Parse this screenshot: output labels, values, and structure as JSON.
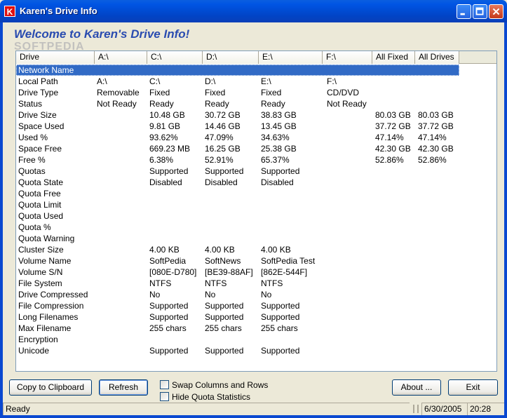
{
  "window": {
    "title": "Karen's Drive Info",
    "icon_letter": "K",
    "welcome": "Welcome to Karen's Drive Info!",
    "watermark": "SOFTPEDIA"
  },
  "table": {
    "headers": [
      "Drive",
      "A:\\",
      "C:\\",
      "D:\\",
      "E:\\",
      "F:\\",
      "All Fixed",
      "All Drives"
    ],
    "rows": [
      [
        "Network Name",
        "",
        "",
        "",
        "",
        "",
        "",
        ""
      ],
      [
        "Local Path",
        "A:\\",
        "C:\\",
        "D:\\",
        "E:\\",
        "F:\\",
        "",
        ""
      ],
      [
        "Drive Type",
        "Removable",
        "Fixed",
        "Fixed",
        "Fixed",
        "CD/DVD",
        "",
        ""
      ],
      [
        "Status",
        "Not Ready",
        "Ready",
        "Ready",
        "Ready",
        "Not Ready",
        "",
        ""
      ],
      [
        "Drive Size",
        "",
        "10.48 GB",
        "30.72 GB",
        "38.83 GB",
        "",
        "80.03 GB",
        "80.03 GB"
      ],
      [
        "Space Used",
        "",
        "9.81 GB",
        "14.46 GB",
        "13.45 GB",
        "",
        "37.72 GB",
        "37.72 GB"
      ],
      [
        "Used %",
        "",
        "93.62%",
        "47.09%",
        "34.63%",
        "",
        "47.14%",
        "47.14%"
      ],
      [
        "Space Free",
        "",
        "669.23 MB",
        "16.25 GB",
        "25.38 GB",
        "",
        "42.30 GB",
        "42.30 GB"
      ],
      [
        "Free %",
        "",
        "6.38%",
        "52.91%",
        "65.37%",
        "",
        "52.86%",
        "52.86%"
      ],
      [
        "Quotas",
        "",
        "Supported",
        "Supported",
        "Supported",
        "",
        "",
        ""
      ],
      [
        "Quota State",
        "",
        "Disabled",
        "Disabled",
        "Disabled",
        "",
        "",
        ""
      ],
      [
        "Quota Free",
        "",
        "",
        "",
        "",
        "",
        "",
        ""
      ],
      [
        "Quota Limit",
        "",
        "",
        "",
        "",
        "",
        "",
        ""
      ],
      [
        "Quota Used",
        "",
        "",
        "",
        "",
        "",
        "",
        ""
      ],
      [
        "Quota %",
        "",
        "",
        "",
        "",
        "",
        "",
        ""
      ],
      [
        "Quota Warning",
        "",
        "",
        "",
        "",
        "",
        "",
        ""
      ],
      [
        "Cluster Size",
        "",
        "4.00 KB",
        "4.00 KB",
        "4.00 KB",
        "",
        "",
        ""
      ],
      [
        "Volume Name",
        "",
        "SoftPedia",
        "SoftNews",
        "SoftPedia Test",
        "",
        "",
        ""
      ],
      [
        "Volume S/N",
        "",
        "[080E-D780]",
        "[BE39-88AF]",
        "[862E-544F]",
        "",
        "",
        ""
      ],
      [
        "File System",
        "",
        "NTFS",
        "NTFS",
        "NTFS",
        "",
        "",
        ""
      ],
      [
        "Drive Compressed",
        "",
        "No",
        "No",
        "No",
        "",
        "",
        ""
      ],
      [
        "File Compression",
        "",
        "Supported",
        "Supported",
        "Supported",
        "",
        "",
        ""
      ],
      [
        "Long Filenames",
        "",
        "Supported",
        "Supported",
        "Supported",
        "",
        "",
        ""
      ],
      [
        "Max Filename",
        "",
        "255 chars",
        "255 chars",
        "255 chars",
        "",
        "",
        ""
      ],
      [
        "Encryption",
        "",
        "",
        "",
        "",
        "",
        "",
        ""
      ],
      [
        "Unicode",
        "",
        "Supported",
        "Supported",
        "Supported",
        "",
        "",
        ""
      ]
    ],
    "selected_row": 0
  },
  "buttons": {
    "copy": "Copy to Clipboard",
    "refresh": "Refresh",
    "about": "About ...",
    "exit": "Exit"
  },
  "options": {
    "swap_label": "Swap Columns and Rows",
    "swap_checked": false,
    "hide_quota_label": "Hide Quota Statistics",
    "hide_quota_checked": false
  },
  "status": {
    "text": "Ready",
    "date": "6/30/2005",
    "time": "20:28"
  },
  "colors": {
    "titlebar": "#0054e3",
    "selection": "#316ac5",
    "welcome_text": "#2a4cb0"
  }
}
